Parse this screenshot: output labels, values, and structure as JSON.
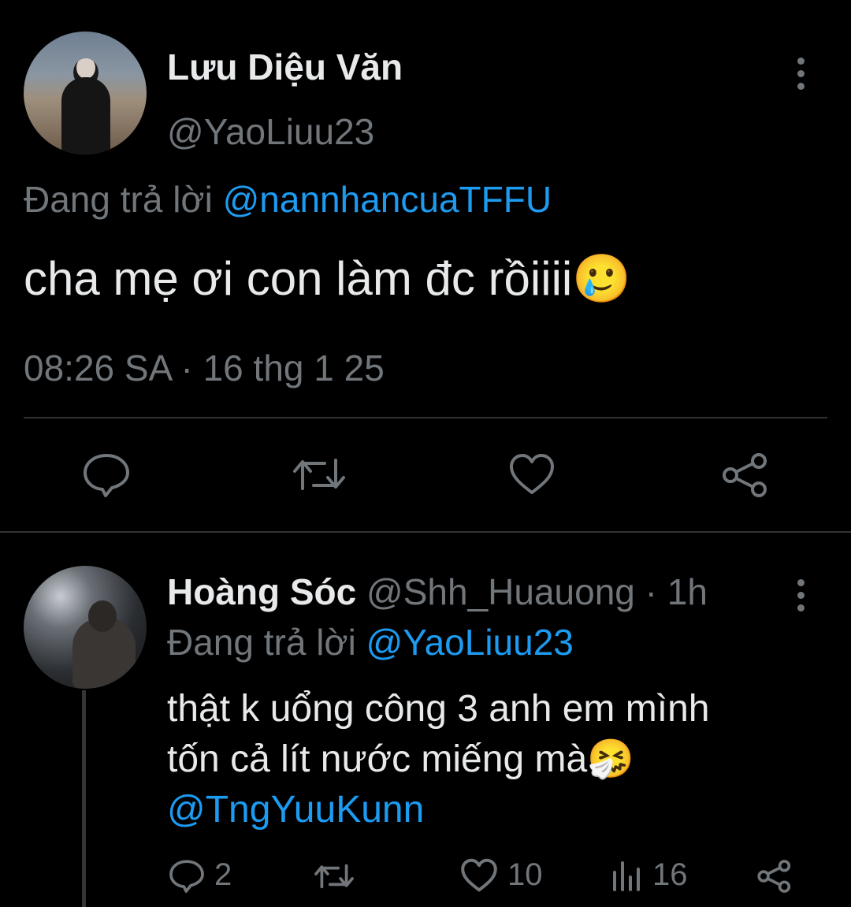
{
  "main_tweet": {
    "display_name": "Lưu Diệu Văn",
    "handle": "@YaoLiuu23",
    "replying_prefix": "Đang trả lời",
    "replying_to": "@nannhancuaTFFU",
    "text": "cha mẹ ơi con làm đc rồiiii",
    "text_emoji": "🥲",
    "timestamp": "08:26 SA · 16 thg 1 25",
    "actions": [
      "reply-icon",
      "retweet-icon",
      "like-icon",
      "share-icon"
    ]
  },
  "reply_tweet": {
    "display_name": "Hoàng Sóc",
    "handle": "@Shh_Huauong",
    "time_sep": "·",
    "time": "1h",
    "replying_prefix": "Đang trả lời",
    "replying_to": "@YaoLiuu23",
    "text_line1": "thật k uổng công 3 anh em mình",
    "text_line2": "tốn cả lít nước miếng mà",
    "text_emoji": "🤧",
    "mention": "@TngYuuKunn",
    "stats": {
      "replies": "2",
      "likes": "10",
      "views": "16"
    }
  },
  "colors": {
    "background": "#000000",
    "text": "#e7e9ea",
    "muted": "#71767b",
    "link": "#1d9bf0",
    "divider": "#2f3336"
  }
}
